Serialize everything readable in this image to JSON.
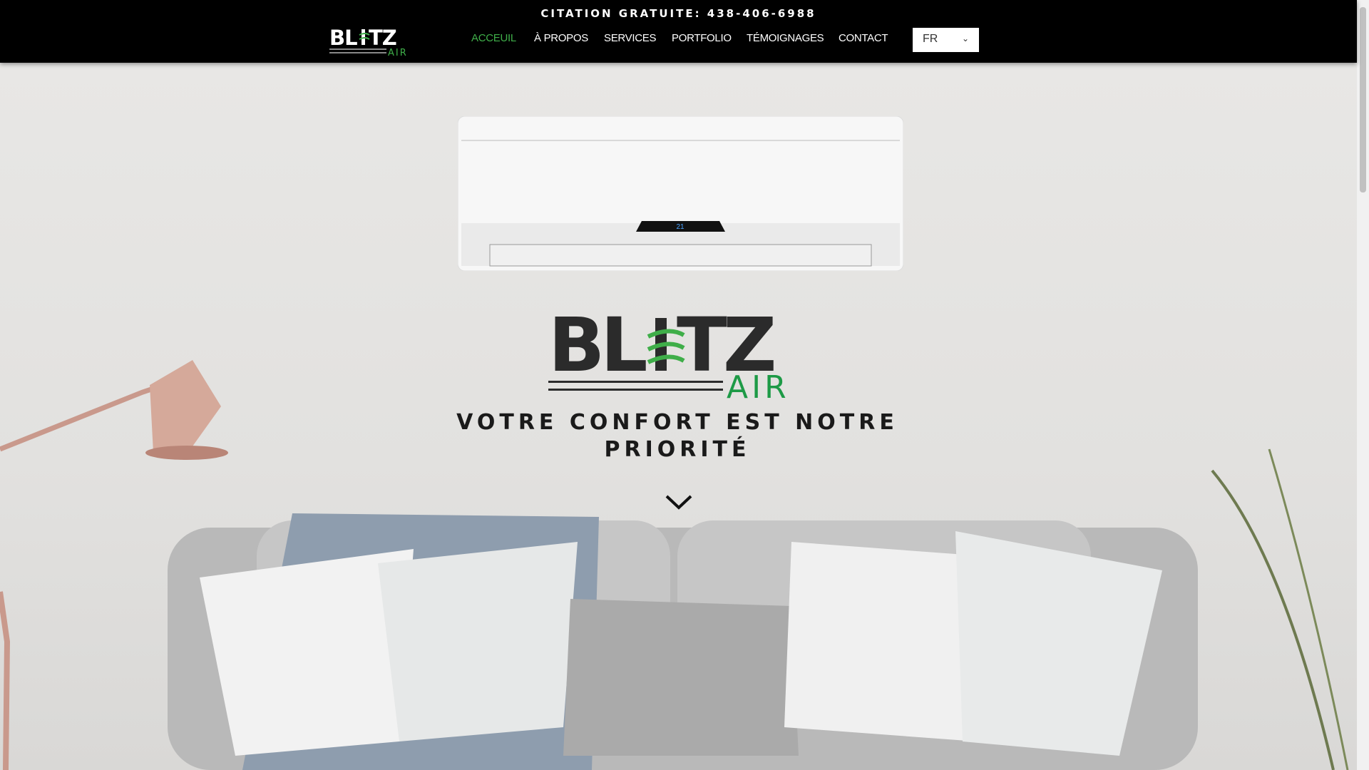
{
  "header": {
    "citation": "CITATION GRATUITE: 438-406-6988",
    "logo_text": "BLITZ AIR",
    "nav": [
      {
        "label": "ACCEUIL",
        "active": true
      },
      {
        "label": "À PROPOS"
      },
      {
        "label": "SERVICES"
      },
      {
        "label": "PORTFOLIO"
      },
      {
        "label": "TÉMOIGNAGES"
      },
      {
        "label": "CONTACT"
      }
    ],
    "language": "FR"
  },
  "hero": {
    "logo_text": "BLITZ AIR",
    "ac_display": "21",
    "tagline_line1": "VOTRE CONFORT EST NOTRE",
    "tagline_line2": "PRIORITÉ"
  },
  "colors": {
    "accent": "#3fae49",
    "header_bg": "#000000"
  }
}
